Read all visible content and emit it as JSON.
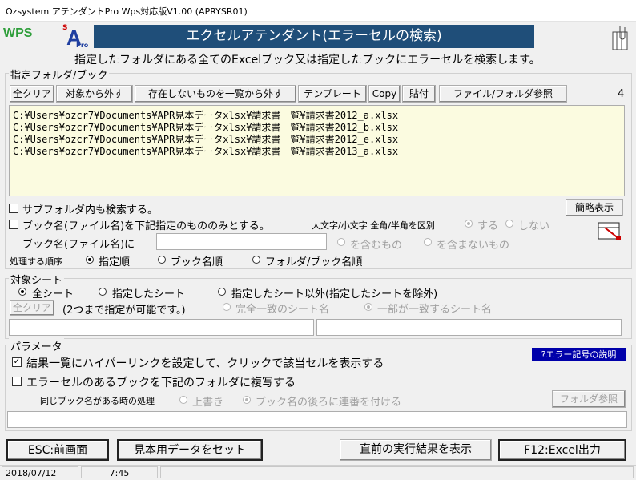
{
  "window": {
    "title": "Ozsystem アテンダントPro Wps対応版V1.00 (APRYSR01)"
  },
  "header": {
    "wps_logo": "WPS",
    "app_logo": "S A Pro",
    "banner": "エクセルアテンダント(エラーセルの検索)",
    "description": "指定したフォルダにある全てのExcelブック又は指定したブックにエラーセルを検索します。"
  },
  "folder_group": {
    "label": "指定フォルダ/ブック",
    "toolbar": [
      "全クリア",
      "対象から外す",
      "存在しないものを一覧から外す",
      "テンプレート",
      "Copy",
      "貼付",
      "ファイル/フォルダ参照"
    ],
    "count": "4",
    "files": [
      "C:¥Users¥ozcr7¥Documents¥APR見本データxlsx¥請求書一覧¥請求書2012_a.xlsx",
      "C:¥Users¥ozcr7¥Documents¥APR見本データxlsx¥請求書一覧¥請求書2012_b.xlsx",
      "C:¥Users¥ozcr7¥Documents¥APR見本データxlsx¥請求書一覧¥請求書2012_e.xlsx",
      "C:¥Users¥ozcr7¥Documents¥APR見本データxlsx¥請求書一覧¥請求書2013_a.xlsx"
    ],
    "subfolder_check": "サブフォルダ内も検索する。",
    "simple_view_button": "簡略表示",
    "bookname_check": "ブック名(ファイル名)を下記指定のもののみとする。",
    "case_label": "大文字/小文字 全角/半角を区別",
    "case_yes": "する",
    "case_no": "しない",
    "bookname_label": "ブック名(ファイル名)に",
    "bookname_value": "",
    "contains": "を含むもの",
    "not_contains": "を含まないもの",
    "order_label": "処理する順序",
    "order_options": [
      "指定順",
      "ブック名順",
      "フォルダ/ブック名順"
    ]
  },
  "sheet_group": {
    "label": "対象シート",
    "options": [
      "全シート",
      "指定したシート",
      "指定したシート以外(指定したシートを除外)"
    ],
    "clear_button": "全クリア",
    "note": "(2つまで指定が可能です。)",
    "match_exact": "完全一致のシート名",
    "match_partial": "一部が一致するシート名",
    "sheet1": "",
    "sheet2": ""
  },
  "param_group": {
    "label": "パラメータ",
    "hyperlink_check": "結果一覧にハイパーリンクを設定して、クリックで該当セルを表示する",
    "help_button": "?エラー記号の説明",
    "copy_check": "エラーセルのあるブックを下記のフォルダに複写する",
    "same_name_label": "同じブック名がある時の処理",
    "overwrite": "上書き",
    "serial": "ブック名の後ろに連番を付ける",
    "folder_button": "フォルダ参照",
    "folder_path": ""
  },
  "footer": {
    "esc_button": "ESC:前画面",
    "sample_button": "見本用データをセット",
    "last_result_button": "直前の実行結果を表示",
    "f12_button": "F12:Excel出力"
  },
  "status": {
    "date": "2018/07/12",
    "time": "7:45"
  },
  "colors": {
    "banner": "#1f4e79",
    "list_bg": "#fbfbe0",
    "help_bg": "#0000aa"
  }
}
